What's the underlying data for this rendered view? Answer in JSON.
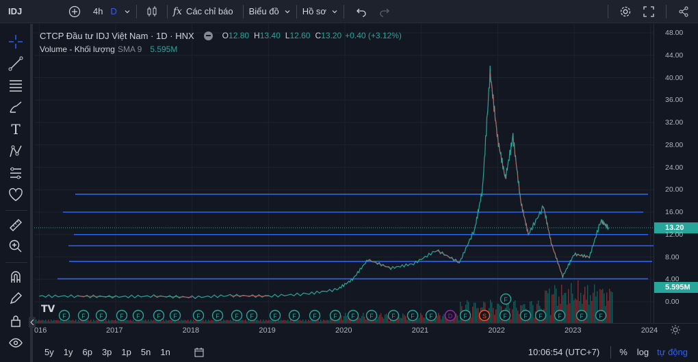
{
  "topbar": {
    "symbol": "IDJ",
    "interval": "4h",
    "interval_alt": "D",
    "indicators_label": "Các chỉ báo",
    "chart_type_label": "Biểu đồ",
    "profile_label": "Hồ sơ"
  },
  "legend": {
    "title": "CTCP Đầu tư IDJ Việt Nam · 1D · HNX",
    "o_label": "O",
    "o_val": "12.80",
    "h_label": "H",
    "h_val": "13.40",
    "l_label": "L",
    "l_val": "12.60",
    "c_label": "C",
    "c_val": "13.20",
    "change": "+0.40 (+3.12%)",
    "volume_label": "Volume - Khối lượng",
    "sma_label": "SMA 9",
    "volume_val": "5.595M"
  },
  "price_scale": {
    "labels": [
      "48.00",
      "44.00",
      "40.00",
      "36.00",
      "32.00",
      "28.00",
      "24.00",
      "20.00",
      "16.00",
      "12.00",
      "8.00",
      "4.00",
      "0.00"
    ],
    "current_price": "13.20",
    "current_volume": "5.595M"
  },
  "time_axis": {
    "labels": [
      "016",
      "2017",
      "2018",
      "2019",
      "2020",
      "2021",
      "2022",
      "2023",
      "2024"
    ]
  },
  "bottombar": {
    "ranges": [
      "5y",
      "1y",
      "6p",
      "3p",
      "1p",
      "5n",
      "1n"
    ],
    "clock": "10:06:54 (UTC+7)",
    "percent": "%",
    "log": "log",
    "auto": "tự động"
  },
  "chart_data": {
    "type": "line",
    "symbol": "IDJ",
    "x": [
      "2016",
      "2016.5",
      "2017",
      "2017.5",
      "2018",
      "2018.5",
      "2019",
      "2019.5",
      "2019.9",
      "2020.1",
      "2020.3",
      "2020.6",
      "2020.9",
      "2021.2",
      "2021.5",
      "2021.7",
      "2021.8",
      "2021.9",
      "2022.0",
      "2022.1",
      "2022.2",
      "2022.3",
      "2022.4",
      "2022.6",
      "2022.7",
      "2022.85",
      "2023.0",
      "2023.2",
      "2023.35",
      "2023.45"
    ],
    "values": [
      1.0,
      1.0,
      0.9,
      1.0,
      0.8,
      1.1,
      1.0,
      1.4,
      2.2,
      4.0,
      7.5,
      6.0,
      6.8,
      9.2,
      7.0,
      13.0,
      20.0,
      41.0,
      29.0,
      22.0,
      29.5,
      18.0,
      12.0,
      17.0,
      10.5,
      4.5,
      8.5,
      8.0,
      14.5,
      13.2
    ],
    "ylim": [
      0,
      48
    ],
    "volume_last": "5.595M",
    "horizontal_levels": [
      19.2,
      16.0,
      12.0,
      10.0,
      7.2,
      4.1
    ],
    "level_color": "#2962ff",
    "up_color": "#26a69a",
    "down_color": "#ef5350"
  }
}
